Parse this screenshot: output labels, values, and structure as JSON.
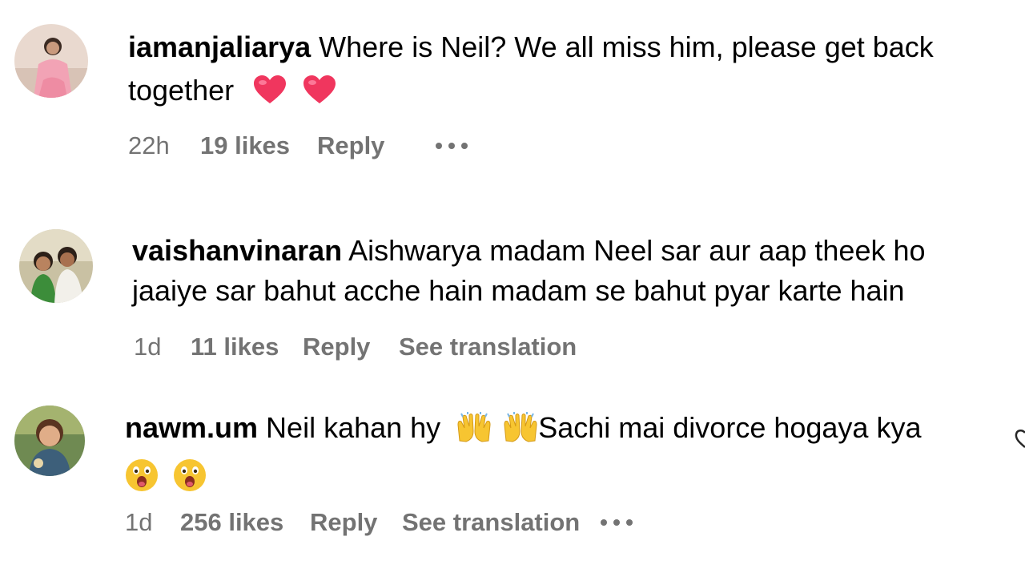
{
  "comments": [
    {
      "username": "iamanjaliarya",
      "text_line1": "Where is Neil? We all miss him, please get back",
      "text_line2": "together",
      "emoji_names": [
        "heart-emoji",
        "heart-emoji"
      ],
      "time": "22h",
      "likes": "19 likes",
      "reply": "Reply",
      "more_icon": "more-options-icon"
    },
    {
      "username": "vaishanvinaran",
      "text_line1": "Aishwarya madam Neel sar aur aap theek ho",
      "text_line2": "jaaiye sar bahut acche hain madam se bahut pyar karte hain",
      "time": "1d",
      "likes": "11 likes",
      "reply": "Reply",
      "translation": "See translation"
    },
    {
      "username": "nawm.um",
      "text_part1": "Neil kahan hy",
      "text_part2": "Sachi mai divorce hogaya kya",
      "emoji_names": [
        "raising-hands-emoji",
        "raising-hands-emoji",
        "astonished-face-emoji",
        "astonished-face-emoji"
      ],
      "time": "1d",
      "likes": "256 likes",
      "reply": "Reply",
      "translation": "See translation",
      "more_icon": "more-options-icon"
    }
  ],
  "colors": {
    "meta_text": "#737373",
    "heart": "#f0365e",
    "emoji_yellow": "#f7c531"
  }
}
